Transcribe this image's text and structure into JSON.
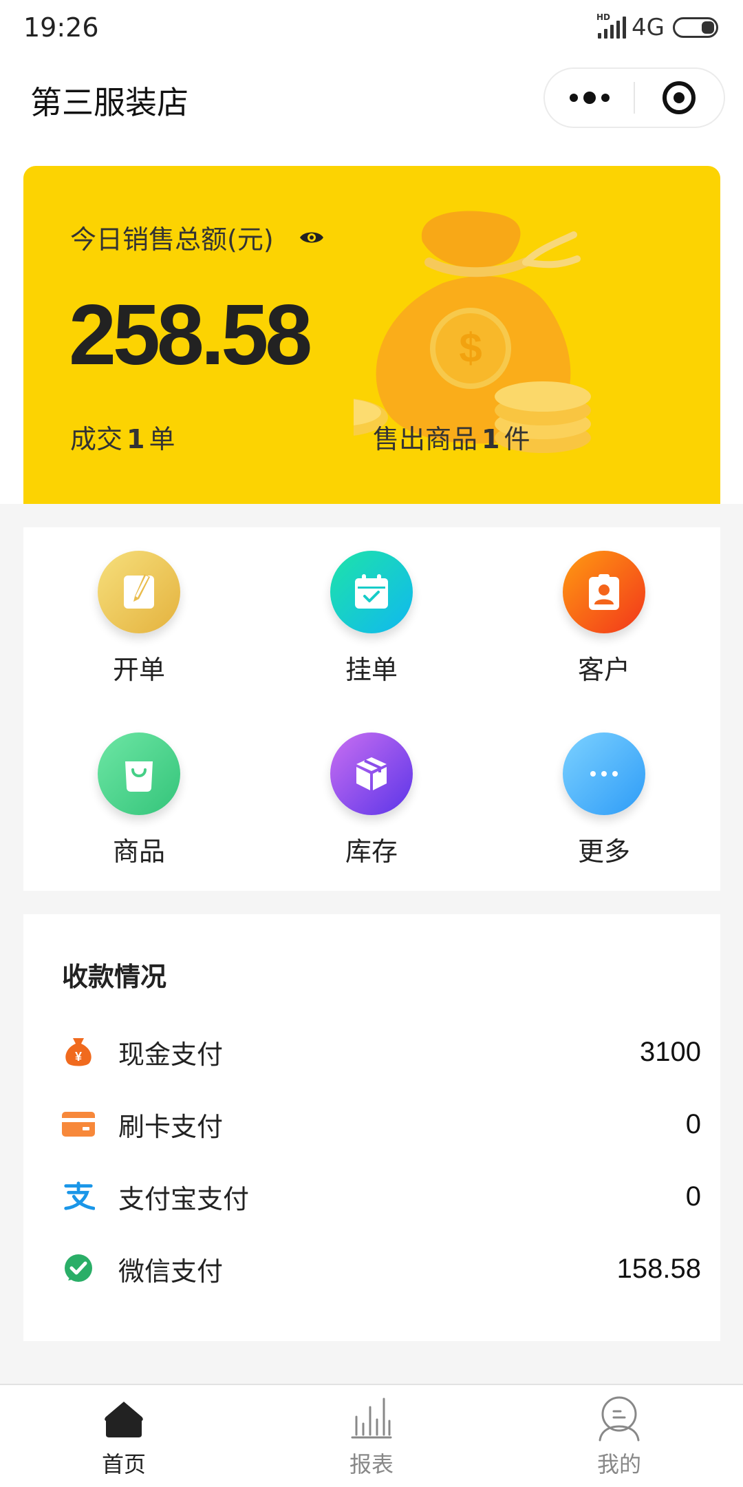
{
  "status_bar": {
    "time": "19:26",
    "network": "4G",
    "hd": "HD"
  },
  "nav": {
    "title": "第三服装店"
  },
  "sales": {
    "label": "今日销售总额(元)",
    "amount": "258.58",
    "deals_prefix": "成交",
    "deals_count": "1",
    "deals_unit": "单",
    "items_prefix": "售出商品",
    "items_count": "1",
    "items_unit": "件"
  },
  "grid": [
    {
      "label": "开单",
      "icon": "pencil-note-icon",
      "gradient": [
        "#f6df7c",
        "#e4b23e"
      ]
    },
    {
      "label": "挂单",
      "icon": "calendar-check-icon",
      "gradient": [
        "#1ee3a8",
        "#10b8f0"
      ]
    },
    {
      "label": "客户",
      "icon": "contact-card-icon",
      "gradient": [
        "#ff9b12",
        "#f2361b"
      ]
    },
    {
      "label": "商品",
      "icon": "shopping-bag-icon",
      "gradient": [
        "#6de6a4",
        "#34c47a"
      ]
    },
    {
      "label": "库存",
      "icon": "package-box-icon",
      "gradient": [
        "#c96ff1",
        "#5b35e8"
      ]
    },
    {
      "label": "更多",
      "icon": "more-dots-icon",
      "gradient": [
        "#7cd1ff",
        "#2e9cf7"
      ]
    }
  ],
  "payments": {
    "title": "收款情况",
    "rows": [
      {
        "label": "现金支付",
        "amount": "3100",
        "icon": "money-bag-icon",
        "color": "#f06a1e"
      },
      {
        "label": "刷卡支付",
        "amount": "0",
        "icon": "bank-card-icon",
        "color": "#f7883a"
      },
      {
        "label": "支付宝支付",
        "amount": "0",
        "icon": "alipay-icon",
        "color": "#1a96e8"
      },
      {
        "label": "微信支付",
        "amount": "158.58",
        "icon": "wechat-pay-icon",
        "color": "#2aae67"
      }
    ]
  },
  "tabs": [
    {
      "label": "首页",
      "icon": "home-icon",
      "active": true
    },
    {
      "label": "报表",
      "icon": "bar-report-icon",
      "active": false
    },
    {
      "label": "我的",
      "icon": "user-profile-icon",
      "active": false
    }
  ],
  "colors": {
    "sales_card": "#fcd302",
    "tab_active": "#222222",
    "tab_inactive": "#888888"
  }
}
